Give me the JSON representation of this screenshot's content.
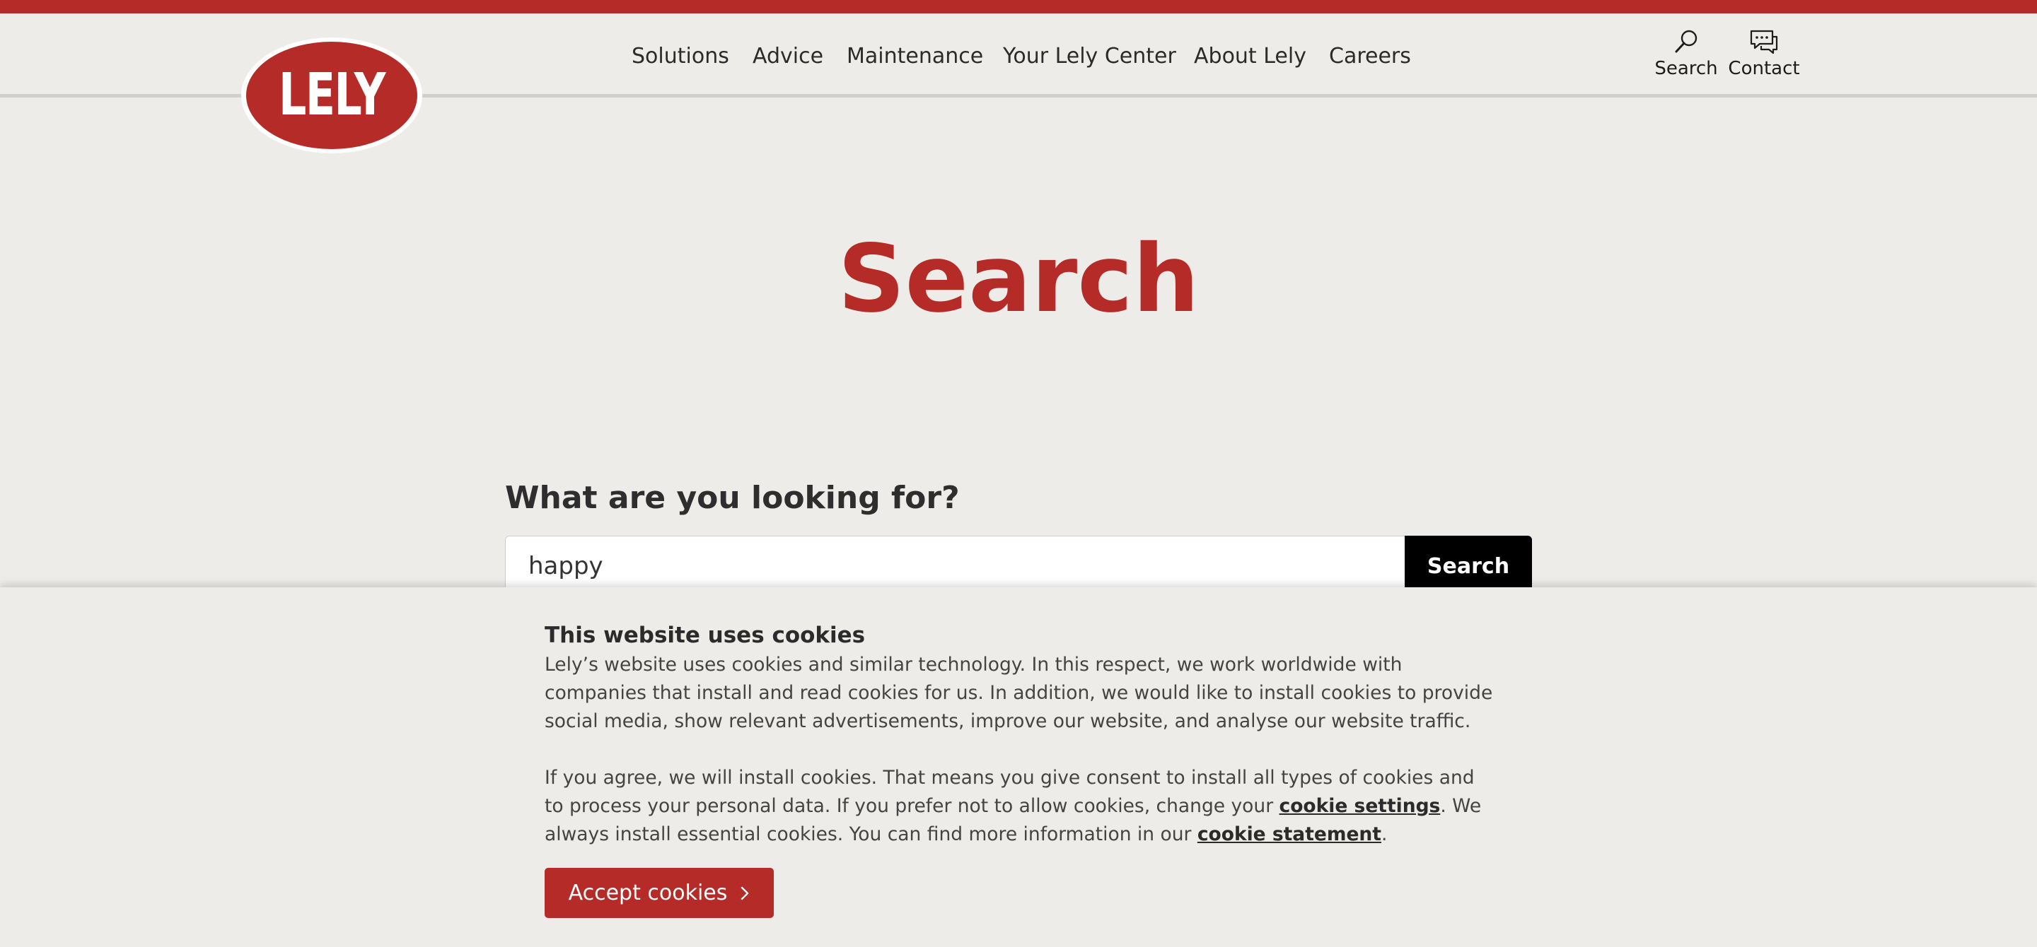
{
  "header": {
    "logo_text": "LELY",
    "brand_color": "#b52b27",
    "nav": [
      "Solutions",
      "Advice",
      "Maintenance",
      "Your Lely Center",
      "About Lely",
      "Careers"
    ],
    "utility": {
      "search_label": "Search",
      "search_icon": "magnifier-icon",
      "contact_label": "Contact",
      "contact_icon": "chat-bubble-icon"
    }
  },
  "main": {
    "title": "Search",
    "question": "What are you looking for?",
    "search_value": "happy",
    "search_button": "Search"
  },
  "cookie_banner": {
    "title": "This website uses cookies",
    "p1": "Lely’s website uses cookies and similar technology. In this respect, we work worldwide with companies that install and read cookies for us. In addition, we would like to install cookies to provide social media, show relevant advertisements, improve our website, and analyse our website traffic.",
    "p2_a": "If you agree, we will install cookies. That means you give consent to install all types of cookies and to process your personal data. If you prefer not to allow cookies, change your ",
    "p2_link1": "cookie settings",
    "p2_b": ". We always install essential cookies. You can find more information in our ",
    "p2_link2": "cookie statement",
    "p2_c": ".",
    "accept_label": "Accept cookies",
    "accept_icon": "chevron-right-icon"
  }
}
